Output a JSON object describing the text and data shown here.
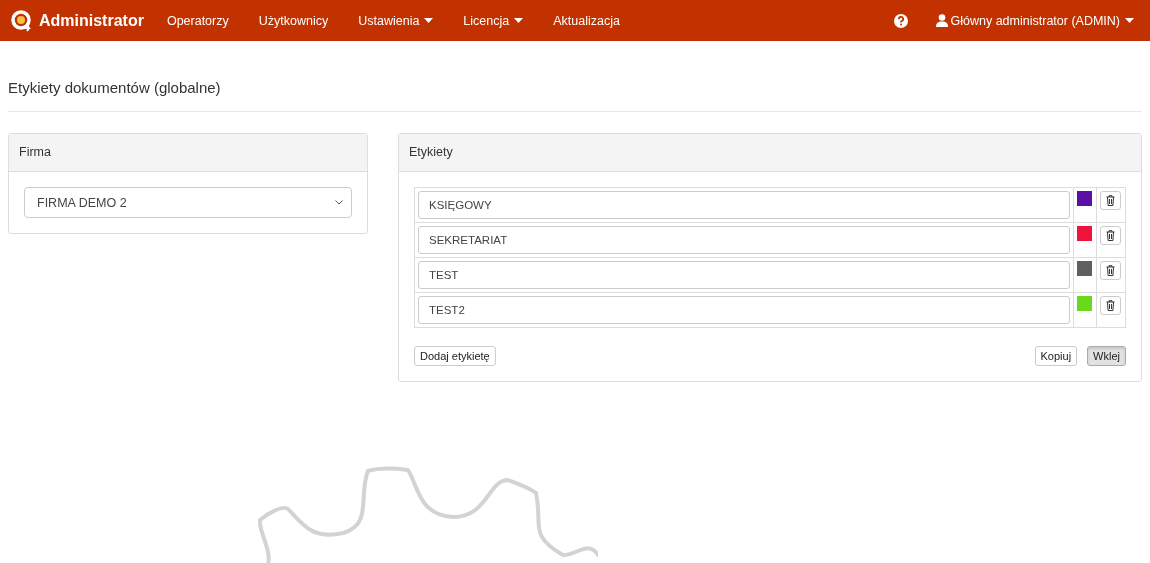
{
  "navbar": {
    "brand": "Administrator",
    "items": [
      {
        "label": "Operatorzy",
        "dropdown": false
      },
      {
        "label": "Użytkownicy",
        "dropdown": false
      },
      {
        "label": "Ustawienia",
        "dropdown": true
      },
      {
        "label": "Licencja",
        "dropdown": true
      },
      {
        "label": "Aktualizacja",
        "dropdown": false
      }
    ],
    "user": "Główny administrator (ADMIN)"
  },
  "page_title": "Etykiety dokumentów (globalne)",
  "firma_panel": {
    "heading": "Firma",
    "select_value": "FIRMA DEMO 2"
  },
  "labels_panel": {
    "heading": "Etykiety",
    "labels": [
      {
        "value": "KSIĘGOWY",
        "color": "#5b0fa5"
      },
      {
        "value": "SEKRETARIAT",
        "color": "#f0143c"
      },
      {
        "value": "TEST",
        "color": "#5f5f5f"
      },
      {
        "value": "TEST2",
        "color": "#69d91e"
      }
    ],
    "add_button": "Dodaj etykietę",
    "buttons": [
      {
        "label": "Kopiuj",
        "active": false
      },
      {
        "label": "Wklej",
        "active": true
      }
    ]
  }
}
